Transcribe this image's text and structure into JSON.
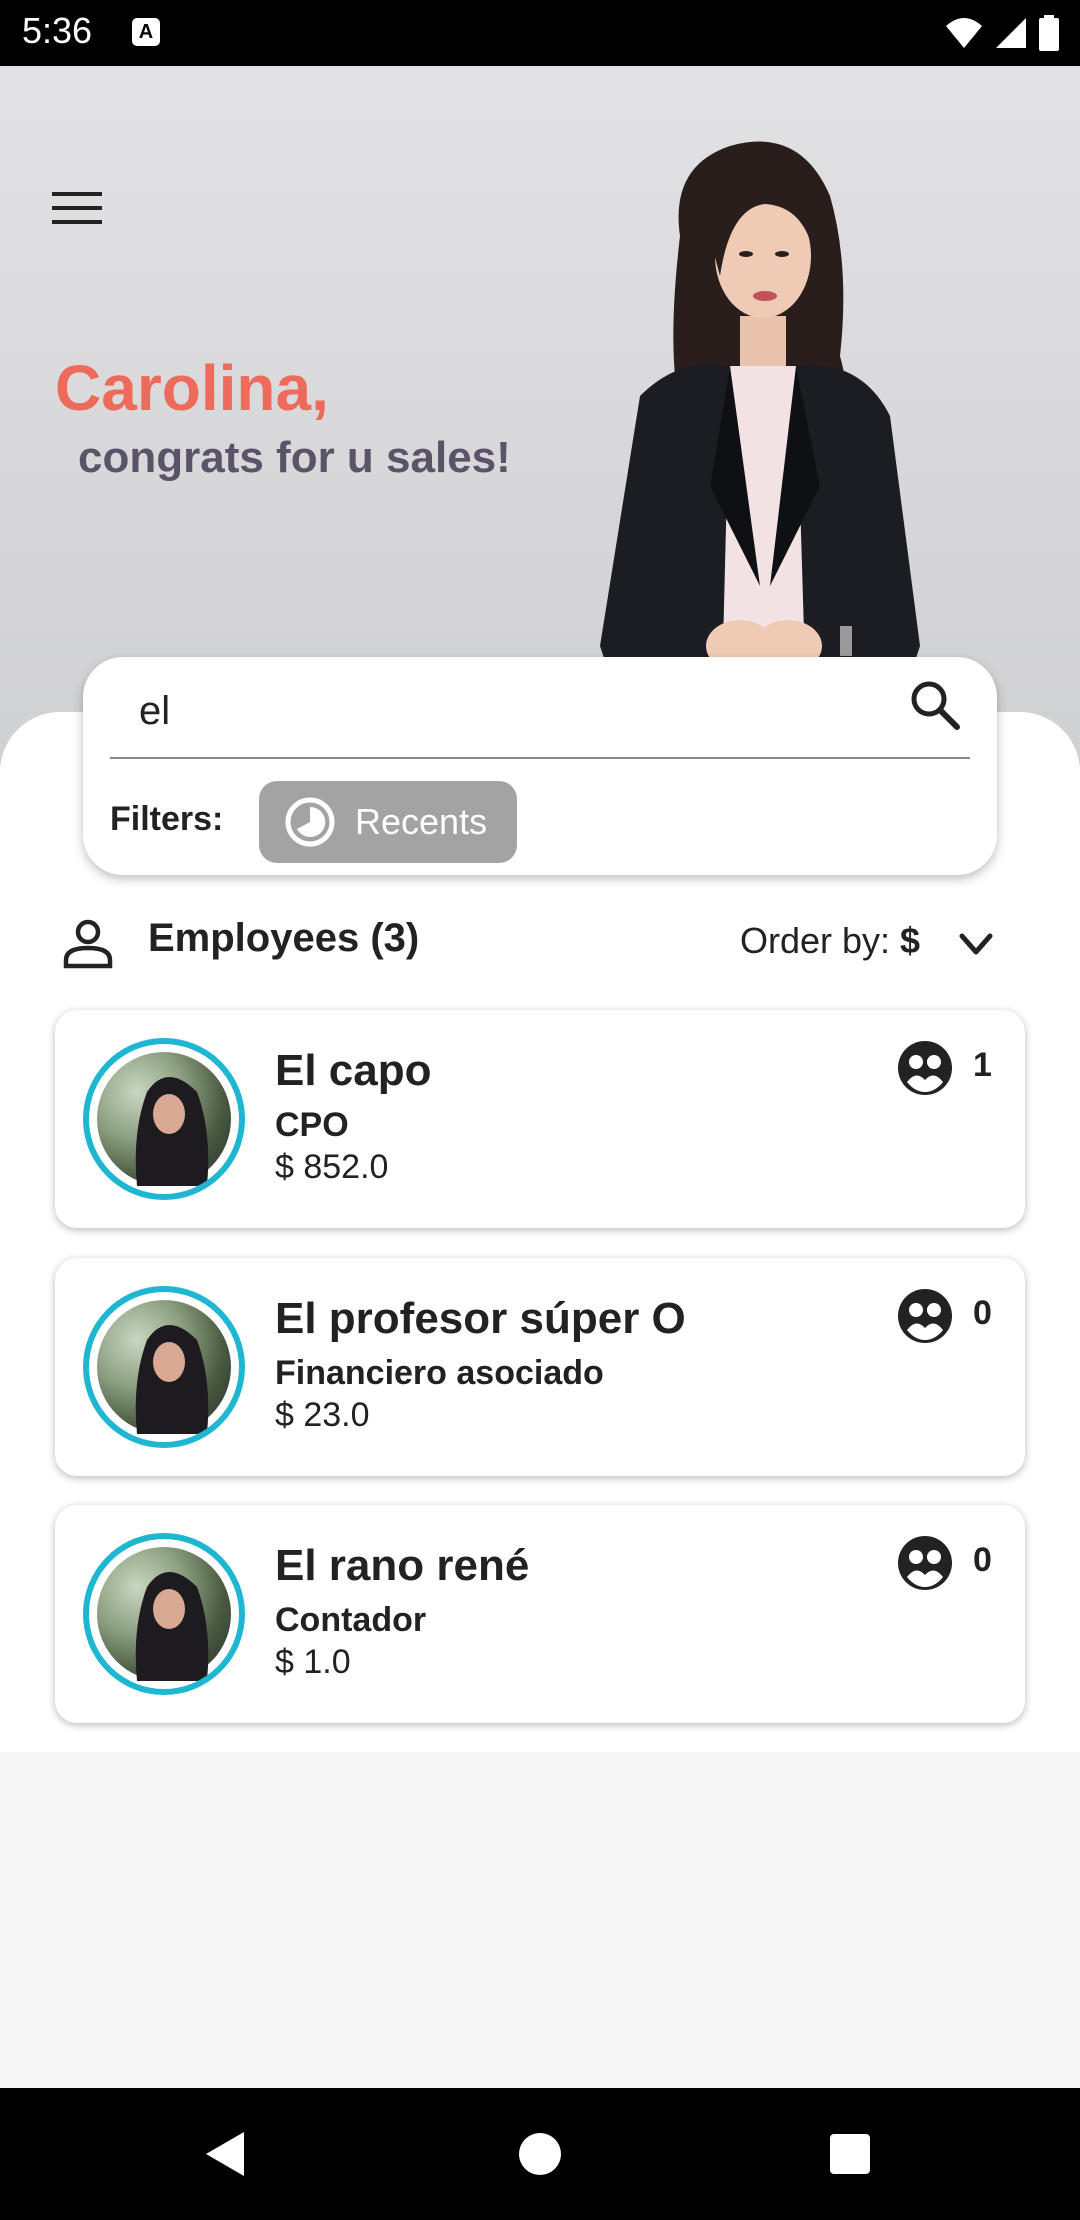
{
  "status_bar": {
    "time": "5:36",
    "notification_glyph": "A"
  },
  "hero": {
    "name": "Carolina,",
    "message": "congrats for u sales!"
  },
  "search": {
    "value": "el",
    "filters_label": "Filters:",
    "chip_label": "Recents"
  },
  "employees": {
    "title": "Employees (3)",
    "order_by_label": "Order by:",
    "order_by_value": "$",
    "items": [
      {
        "name": "El capo",
        "role": "CPO",
        "amount": "$ 852.0",
        "team_count": "1"
      },
      {
        "name": "El profesor súper O",
        "role": "Financiero asociado",
        "amount": "$ 23.0",
        "team_count": "0"
      },
      {
        "name": "El rano rené",
        "role": "Contador",
        "amount": "$ 1.0",
        "team_count": "0"
      }
    ]
  },
  "colors": {
    "accent_name": "#ee6a5a",
    "accent_message": "#5b5468",
    "avatar_ring": "#1fb6d1",
    "chip_bg": "#a3a3a3"
  },
  "icons": [
    "menu-icon",
    "search-icon",
    "history-icon",
    "person-icon",
    "chevron-down-icon",
    "team-icon",
    "back-icon",
    "home-icon",
    "recents-icon"
  ]
}
